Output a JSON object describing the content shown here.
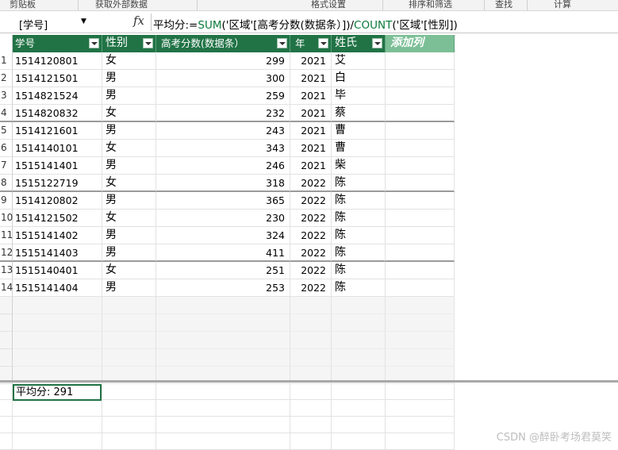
{
  "ribbon": {
    "groups": [
      "剪贴板",
      "获取外部数据",
      "格式设置",
      "排序和筛选",
      "查找",
      "计算"
    ]
  },
  "formula_bar": {
    "name_box": "[学号]",
    "fx_label": "fx",
    "formula_prefix": "平均分:=",
    "fn_sum": "SUM",
    "part1": "('区域'[高考分数(数据条）])/",
    "fn_count": "COUNT",
    "part2": "('区域'[性别])"
  },
  "table": {
    "headers": [
      "学号",
      "性别",
      "高考分数(数据条）",
      "年",
      "姓氏"
    ],
    "add_column": "添加列",
    "rows": [
      {
        "n": "1",
        "id": "1514120801",
        "sex": "女",
        "score": "299",
        "year": "2021",
        "name": "艾"
      },
      {
        "n": "2",
        "id": "1514121501",
        "sex": "男",
        "score": "300",
        "year": "2021",
        "name": "白"
      },
      {
        "n": "3",
        "id": "1514821524",
        "sex": "男",
        "score": "259",
        "year": "2021",
        "name": "毕"
      },
      {
        "n": "4",
        "id": "1514820832",
        "sex": "女",
        "score": "232",
        "year": "2021",
        "name": "蔡"
      },
      {
        "n": "5",
        "id": "1514121601",
        "sex": "男",
        "score": "243",
        "year": "2021",
        "name": "曹"
      },
      {
        "n": "6",
        "id": "1514140101",
        "sex": "女",
        "score": "343",
        "year": "2021",
        "name": "曹"
      },
      {
        "n": "7",
        "id": "1515141401",
        "sex": "男",
        "score": "246",
        "year": "2021",
        "name": "柴"
      },
      {
        "n": "8",
        "id": "1515122719",
        "sex": "女",
        "score": "318",
        "year": "2022",
        "name": "陈"
      },
      {
        "n": "9",
        "id": "1514120802",
        "sex": "男",
        "score": "365",
        "year": "2022",
        "name": "陈"
      },
      {
        "n": "10",
        "id": "1514121502",
        "sex": "女",
        "score": "230",
        "year": "2022",
        "name": "陈"
      },
      {
        "n": "11",
        "id": "1515141402",
        "sex": "男",
        "score": "324",
        "year": "2022",
        "name": "陈"
      },
      {
        "n": "12",
        "id": "1515141403",
        "sex": "男",
        "score": "411",
        "year": "2022",
        "name": "陈"
      },
      {
        "n": "13",
        "id": "1515140401",
        "sex": "女",
        "score": "251",
        "year": "2022",
        "name": "陈"
      },
      {
        "n": "14",
        "id": "1515141404",
        "sex": "男",
        "score": "253",
        "year": "2022",
        "name": "陈"
      }
    ]
  },
  "calc_area": {
    "measure": "平均分: 291"
  },
  "watermark": "CSDN @醉卧考场君莫笑",
  "colors": {
    "header_green": "#217346",
    "add_column_green": "#7cbf96",
    "function_green": "#0a7a3a"
  }
}
